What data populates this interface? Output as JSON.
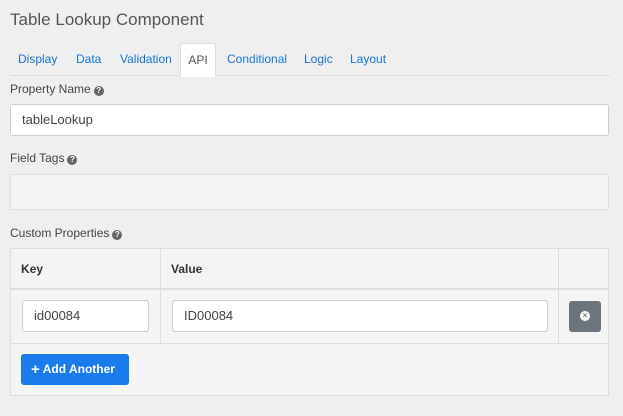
{
  "title": "Table Lookup Component",
  "tabs": [
    {
      "label": "Display"
    },
    {
      "label": "Data"
    },
    {
      "label": "Validation"
    },
    {
      "label": "API"
    },
    {
      "label": "Conditional"
    },
    {
      "label": "Logic"
    },
    {
      "label": "Layout"
    }
  ],
  "active_tab": "API",
  "property_name": {
    "label": "Property Name",
    "value": "tableLookup"
  },
  "field_tags": {
    "label": "Field Tags",
    "value": ""
  },
  "custom_properties": {
    "label": "Custom Properties",
    "columns": [
      "Key",
      "Value"
    ],
    "rows": [
      {
        "key": "id00084",
        "value": "ID00084"
      }
    ],
    "add_label": "Add Another"
  },
  "icons": {
    "help": "question-circle-icon",
    "remove": "remove-circle-icon",
    "add": "plus-icon"
  },
  "colors": {
    "link": "#1a75d2",
    "primary_button": "#1a7bea",
    "remove_button": "#6c757d"
  }
}
